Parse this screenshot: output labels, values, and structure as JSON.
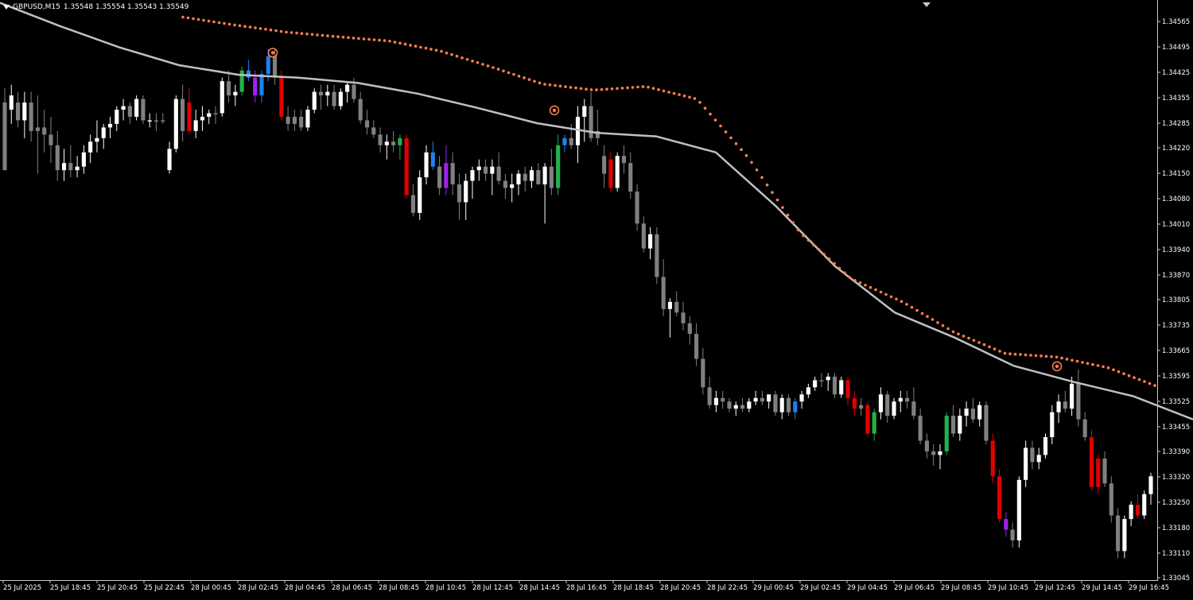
{
  "header": {
    "symbol_timeframe": "GBPUSD,M15",
    "ohlc": "1.35548 1.35554 1.35543 1.35549"
  },
  "colors": {
    "background": "#000000",
    "bull_candle": "#ffffff",
    "bear_candle": "#808080",
    "highlight_green": "#22b14c",
    "highlight_blue": "#1e7ff0",
    "highlight_purple": "#a020f0",
    "highlight_red": "#e00000",
    "moving_average": "#c0c0c0",
    "dotted_band": "#ff7f50",
    "signal_marker": "#ff7f50",
    "axis_text": "#ffffff"
  },
  "chart_data": {
    "type": "candlestick",
    "ylim": [
      1.33045,
      1.3461
    ],
    "y_ticks": [
      "1.34565",
      "1.34495",
      "1.34425",
      "1.34355",
      "1.34285",
      "1.34220",
      "1.34150",
      "1.34080",
      "1.34010",
      "1.33940",
      "1.33870",
      "1.33805",
      "1.33735",
      "1.33665",
      "1.33595",
      "1.33525",
      "1.33455",
      "1.33390",
      "1.33320",
      "1.33250",
      "1.33180",
      "1.33110",
      "1.33045"
    ],
    "x_ticks": [
      "25 Jul 2025",
      "25 Jul 18:45",
      "25 Jul 20:45",
      "25 Jul 22:45",
      "28 Jul 00:45",
      "28 Jul 02:45",
      "28 Jul 04:45",
      "28 Jul 06:45",
      "28 Jul 08:45",
      "28 Jul 10:45",
      "28 Jul 12:45",
      "28 Jul 14:45",
      "28 Jul 16:45",
      "28 Jul 18:45",
      "28 Jul 20:45",
      "28 Jul 22:45",
      "29 Jul 00:45",
      "29 Jul 02:45",
      "29 Jul 04:45",
      "29 Jul 06:45",
      "29 Jul 08:45",
      "29 Jul 10:45",
      "29 Jul 12:45",
      "29 Jul 14:45",
      "29 Jul 16:45"
    ],
    "moving_average": [
      1.3466,
      1.34595,
      1.34535,
      1.34485,
      1.34458,
      1.3445,
      1.34435,
      1.34405,
      1.34365,
      1.34322,
      1.34295,
      1.34285,
      1.3424,
      1.3409,
      1.3392,
      1.3379,
      1.3372,
      1.3364,
      1.33595,
      1.33555,
      1.3349
    ],
    "upper_band": [
      1.3462,
      1.34598,
      1.34578,
      1.34565,
      1.34553,
      1.34525,
      1.3448,
      1.34432,
      1.34415,
      1.34425,
      1.3439,
      1.34225,
      1.34015,
      1.33885,
      1.3382,
      1.33735,
      1.33675,
      1.33665,
      1.33635,
      1.3358
    ],
    "signals": [
      1.3452,
      1.34358,
      1.33639
    ],
    "candles": [
      [
        1.3438,
        1.3442,
        1.3419,
        1.3419,
        "bear"
      ],
      [
        1.3436,
        1.3443,
        1.3432,
        1.344,
        "bull"
      ],
      [
        1.3438,
        1.3441,
        1.3431,
        1.3433,
        "bear"
      ],
      [
        1.3433,
        1.3441,
        1.3428,
        1.3438,
        "bull"
      ],
      [
        1.3438,
        1.3441,
        1.3427,
        1.343,
        "bear"
      ],
      [
        1.343,
        1.344,
        1.3418,
        1.3431,
        "bear"
      ],
      [
        1.3431,
        1.3436,
        1.3424,
        1.3429,
        "bear"
      ],
      [
        1.3429,
        1.3434,
        1.3421,
        1.3426,
        "bear"
      ],
      [
        1.3426,
        1.343,
        1.3416,
        1.3419,
        "bear"
      ],
      [
        1.3419,
        1.3425,
        1.3416,
        1.3421,
        "bull"
      ],
      [
        1.3421,
        1.3426,
        1.3417,
        1.3419,
        "bear"
      ],
      [
        1.3419,
        1.3423,
        1.3417,
        1.342,
        "bull"
      ],
      [
        1.342,
        1.3426,
        1.3418,
        1.3424,
        "bull"
      ],
      [
        1.3424,
        1.3429,
        1.3421,
        1.3427,
        "bull"
      ],
      [
        1.3427,
        1.3433,
        1.3424,
        1.3428,
        "bull"
      ],
      [
        1.3428,
        1.3432,
        1.3425,
        1.3431,
        "bull"
      ],
      [
        1.3431,
        1.3434,
        1.3428,
        1.3432,
        "bull"
      ],
      [
        1.3432,
        1.3437,
        1.343,
        1.3436,
        "bull"
      ],
      [
        1.3436,
        1.3439,
        1.3433,
        1.3437,
        "bull"
      ],
      [
        1.3437,
        1.3438,
        1.3432,
        1.3434,
        "bear"
      ],
      [
        1.3434,
        1.344,
        1.3433,
        1.3439,
        "bull"
      ],
      [
        1.3439,
        1.344,
        1.3432,
        1.3433,
        "bear"
      ],
      [
        1.3433,
        1.3435,
        1.3431,
        1.3433,
        "bull"
      ],
      [
        1.3433,
        1.3435,
        1.343,
        1.3433,
        "bear"
      ],
      [
        1.3433,
        1.3435,
        1.3432,
        1.3433,
        "bear"
      ],
      [
        1.3419,
        1.3427,
        1.3418,
        1.3425,
        "bull"
      ],
      [
        1.3425,
        1.344,
        1.3424,
        1.3439,
        "bull"
      ],
      [
        1.3439,
        1.3443,
        1.3427,
        1.343,
        "bear"
      ],
      [
        1.3438,
        1.3442,
        1.3429,
        1.343,
        "red"
      ],
      [
        1.343,
        1.3436,
        1.3428,
        1.3433,
        "bull"
      ],
      [
        1.3433,
        1.3437,
        1.343,
        1.3434,
        "bull"
      ],
      [
        1.3434,
        1.3436,
        1.3432,
        1.3435,
        "bull"
      ],
      [
        1.3435,
        1.3437,
        1.3432,
        1.3435,
        "bear"
      ],
      [
        1.3435,
        1.3445,
        1.3434,
        1.3444,
        "bull"
      ],
      [
        1.3444,
        1.3447,
        1.3438,
        1.344,
        "bear"
      ],
      [
        1.344,
        1.3443,
        1.3437,
        1.3441,
        "bull"
      ],
      [
        1.3441,
        1.3448,
        1.344,
        1.3447,
        "green"
      ],
      [
        1.3447,
        1.345,
        1.3444,
        1.3445,
        "blue"
      ],
      [
        1.3445,
        1.3447,
        1.3438,
        1.344,
        "purple"
      ],
      [
        1.344,
        1.3447,
        1.3438,
        1.3446,
        "blue"
      ],
      [
        1.3446,
        1.3453,
        1.3444,
        1.3451,
        "blue"
      ],
      [
        1.3451,
        1.3453,
        1.3443,
        1.3445,
        "bear"
      ],
      [
        1.3445,
        1.3447,
        1.3433,
        1.3434,
        "red"
      ],
      [
        1.3434,
        1.3437,
        1.343,
        1.3432,
        "bear"
      ],
      [
        1.3432,
        1.3436,
        1.343,
        1.3434,
        "bear"
      ],
      [
        1.3434,
        1.3436,
        1.343,
        1.3431,
        "bear"
      ],
      [
        1.3431,
        1.3437,
        1.343,
        1.3436,
        "bull"
      ],
      [
        1.3436,
        1.3442,
        1.3435,
        1.3441,
        "bull"
      ],
      [
        1.3441,
        1.3443,
        1.3436,
        1.344,
        "bear"
      ],
      [
        1.344,
        1.3443,
        1.3437,
        1.3441,
        "bull"
      ],
      [
        1.3441,
        1.3443,
        1.3436,
        1.3437,
        "bear"
      ],
      [
        1.3437,
        1.3442,
        1.3436,
        1.3441,
        "bull"
      ],
      [
        1.3441,
        1.3444,
        1.3438,
        1.3443,
        "bull"
      ],
      [
        1.3443,
        1.3445,
        1.3438,
        1.3439,
        "bear"
      ],
      [
        1.3439,
        1.3441,
        1.3432,
        1.3433,
        "bear"
      ],
      [
        1.3433,
        1.3436,
        1.3429,
        1.3431,
        "bear"
      ],
      [
        1.3431,
        1.3433,
        1.3428,
        1.3429,
        "bear"
      ],
      [
        1.3429,
        1.3431,
        1.3424,
        1.3426,
        "bear"
      ],
      [
        1.3426,
        1.3429,
        1.3422,
        1.3427,
        "bull"
      ],
      [
        1.3427,
        1.343,
        1.3424,
        1.3426,
        "bear"
      ],
      [
        1.3426,
        1.3429,
        1.3422,
        1.3428,
        "green"
      ],
      [
        1.3428,
        1.3429,
        1.3411,
        1.3412,
        "red"
      ],
      [
        1.3412,
        1.3415,
        1.3406,
        1.3407,
        "bear"
      ],
      [
        1.3407,
        1.3419,
        1.3405,
        1.3417,
        "bull"
      ],
      [
        1.3417,
        1.3426,
        1.3415,
        1.3424,
        "bull"
      ],
      [
        1.3424,
        1.3427,
        1.3419,
        1.342,
        "blue"
      ],
      [
        1.342,
        1.3423,
        1.3412,
        1.3414,
        "bear"
      ],
      [
        1.3414,
        1.3426,
        1.3412,
        1.3421,
        "purple"
      ],
      [
        1.3421,
        1.3424,
        1.3412,
        1.3415,
        "bear"
      ],
      [
        1.3415,
        1.3418,
        1.3405,
        1.341,
        "bear"
      ],
      [
        1.341,
        1.3418,
        1.3405,
        1.3416,
        "bull"
      ],
      [
        1.3416,
        1.342,
        1.3411,
        1.3419,
        "bull"
      ],
      [
        1.3419,
        1.3422,
        1.3416,
        1.342,
        "bull"
      ],
      [
        1.342,
        1.3422,
        1.3416,
        1.3418,
        "bear"
      ],
      [
        1.3418,
        1.3422,
        1.3412,
        1.342,
        "bull"
      ],
      [
        1.342,
        1.3424,
        1.3415,
        1.3416,
        "bear"
      ],
      [
        1.3416,
        1.3418,
        1.3411,
        1.3414,
        "bear"
      ],
      [
        1.3414,
        1.3418,
        1.341,
        1.3415,
        "bull"
      ],
      [
        1.3415,
        1.3419,
        1.3412,
        1.3418,
        "bull"
      ],
      [
        1.3418,
        1.342,
        1.3413,
        1.3416,
        "bear"
      ],
      [
        1.3416,
        1.342,
        1.3414,
        1.3419,
        "bull"
      ],
      [
        1.3419,
        1.3421,
        1.3415,
        1.3415,
        "bear"
      ],
      [
        1.3415,
        1.3421,
        1.3404,
        1.342,
        "bull"
      ],
      [
        1.342,
        1.3425,
        1.3412,
        1.3414,
        "bear"
      ],
      [
        1.3414,
        1.3429,
        1.3412,
        1.3426,
        "green"
      ],
      [
        1.3426,
        1.3429,
        1.3424,
        1.3428,
        "blue"
      ],
      [
        1.3428,
        1.3432,
        1.3425,
        1.3426,
        "bear"
      ],
      [
        1.3426,
        1.3437,
        1.3421,
        1.3434,
        "bull"
      ],
      [
        1.3434,
        1.3439,
        1.3427,
        1.3437,
        "bull"
      ],
      [
        1.3437,
        1.3441,
        1.3427,
        1.3428,
        "bear"
      ],
      [
        1.3428,
        1.3436,
        1.3426,
        1.343,
        "bear"
      ],
      [
        1.3423,
        1.3426,
        1.3414,
        1.3418,
        "bear"
      ],
      [
        1.3422,
        1.3424,
        1.3413,
        1.3414,
        "red"
      ],
      [
        1.3414,
        1.3424,
        1.3413,
        1.3423,
        "bull"
      ],
      [
        1.3423,
        1.3426,
        1.3418,
        1.3421,
        "bear"
      ],
      [
        1.3421,
        1.3424,
        1.3411,
        1.3413,
        "bear"
      ],
      [
        1.3413,
        1.3415,
        1.3402,
        1.3404,
        "bear"
      ],
      [
        1.3404,
        1.3406,
        1.3396,
        1.3397,
        "bear"
      ],
      [
        1.3397,
        1.3403,
        1.3394,
        1.3401,
        "bull"
      ],
      [
        1.3401,
        1.3403,
        1.3387,
        1.3389,
        "bear"
      ],
      [
        1.3389,
        1.3394,
        1.3378,
        1.338,
        "bear"
      ],
      [
        1.338,
        1.3383,
        1.3372,
        1.3382,
        "bull"
      ],
      [
        1.3382,
        1.3385,
        1.3378,
        1.3379,
        "bear"
      ],
      [
        1.3379,
        1.3382,
        1.3374,
        1.3376,
        "bear"
      ],
      [
        1.3376,
        1.3378,
        1.337,
        1.3373,
        "bear"
      ],
      [
        1.3373,
        1.3376,
        1.3364,
        1.3366,
        "bear"
      ],
      [
        1.3366,
        1.3369,
        1.3356,
        1.3358,
        "bear"
      ],
      [
        1.3358,
        1.3361,
        1.3352,
        1.3353,
        "bear"
      ],
      [
        1.3353,
        1.3357,
        1.3351,
        1.3355,
        "bull"
      ],
      [
        1.3355,
        1.3357,
        1.3352,
        1.3354,
        "bear"
      ],
      [
        1.3354,
        1.3355,
        1.3351,
        1.3352,
        "bear"
      ],
      [
        1.3352,
        1.3354,
        1.335,
        1.3353,
        "bull"
      ],
      [
        1.3353,
        1.3355,
        1.3351,
        1.3352,
        "bear"
      ],
      [
        1.3352,
        1.3355,
        1.3351,
        1.3354,
        "bull"
      ],
      [
        1.3354,
        1.3357,
        1.3353,
        1.3355,
        "bull"
      ],
      [
        1.3355,
        1.3357,
        1.3353,
        1.3354,
        "bear"
      ],
      [
        1.3354,
        1.3356,
        1.3352,
        1.3356,
        "bull"
      ],
      [
        1.3356,
        1.3357,
        1.335,
        1.3351,
        "bear"
      ],
      [
        1.3351,
        1.3356,
        1.3349,
        1.3355,
        "bull"
      ],
      [
        1.3355,
        1.3356,
        1.335,
        1.3351,
        "bear"
      ],
      [
        1.3351,
        1.3355,
        1.3349,
        1.3354,
        "blue"
      ],
      [
        1.3354,
        1.3357,
        1.3352,
        1.3356,
        "bull"
      ],
      [
        1.3356,
        1.3359,
        1.3355,
        1.3358,
        "bull"
      ],
      [
        1.3358,
        1.3361,
        1.3357,
        1.336,
        "bull"
      ],
      [
        1.336,
        1.3362,
        1.3358,
        1.336,
        "bear"
      ],
      [
        1.336,
        1.3362,
        1.3357,
        1.3361,
        "bull"
      ],
      [
        1.3361,
        1.3362,
        1.3355,
        1.3356,
        "bear"
      ],
      [
        1.3356,
        1.3361,
        1.3355,
        1.336,
        "bull"
      ],
      [
        1.336,
        1.3361,
        1.3353,
        1.3355,
        "red"
      ],
      [
        1.3355,
        1.3357,
        1.335,
        1.3352,
        "red"
      ],
      [
        1.3352,
        1.3355,
        1.335,
        1.3353,
        "bear"
      ],
      [
        1.3353,
        1.3354,
        1.3344,
        1.3345,
        "red"
      ],
      [
        1.3345,
        1.3352,
        1.3343,
        1.3351,
        "green"
      ],
      [
        1.3351,
        1.3358,
        1.3349,
        1.3356,
        "bull"
      ],
      [
        1.3356,
        1.3357,
        1.3348,
        1.335,
        "bear"
      ],
      [
        1.335,
        1.3355,
        1.3349,
        1.3354,
        "bull"
      ],
      [
        1.3354,
        1.3357,
        1.3351,
        1.3355,
        "bull"
      ],
      [
        1.3355,
        1.3357,
        1.3352,
        1.3354,
        "bear"
      ],
      [
        1.3354,
        1.3358,
        1.3349,
        1.335,
        "bear"
      ],
      [
        1.335,
        1.3352,
        1.3342,
        1.3343,
        "bear"
      ],
      [
        1.3343,
        1.3345,
        1.3338,
        1.334,
        "bear"
      ],
      [
        1.334,
        1.3342,
        1.3336,
        1.3339,
        "bear"
      ],
      [
        1.3339,
        1.3342,
        1.3335,
        1.334,
        "bull"
      ],
      [
        1.334,
        1.3351,
        1.3339,
        1.335,
        "green"
      ],
      [
        1.335,
        1.3353,
        1.3344,
        1.3345,
        "bear"
      ],
      [
        1.3345,
        1.3352,
        1.3343,
        1.335,
        "bull"
      ],
      [
        1.335,
        1.3354,
        1.3347,
        1.3352,
        "bull"
      ],
      [
        1.3352,
        1.3355,
        1.3348,
        1.3349,
        "bear"
      ],
      [
        1.3349,
        1.3354,
        1.3347,
        1.3353,
        "bull"
      ],
      [
        1.3353,
        1.3354,
        1.3342,
        1.3343,
        "bear"
      ],
      [
        1.3343,
        1.3345,
        1.3331,
        1.3333,
        "red"
      ],
      [
        1.3333,
        1.3335,
        1.332,
        1.3321,
        "red"
      ],
      [
        1.3321,
        1.3323,
        1.3316,
        1.3318,
        "purple"
      ],
      [
        1.3318,
        1.332,
        1.3313,
        1.3315,
        "bear"
      ],
      [
        1.3315,
        1.3333,
        1.3313,
        1.3332,
        "bull"
      ],
      [
        1.3332,
        1.3343,
        1.333,
        1.3341,
        "bull"
      ],
      [
        1.3341,
        1.3343,
        1.3335,
        1.3337,
        "bear"
      ],
      [
        1.3337,
        1.3341,
        1.3335,
        1.3339,
        "bull"
      ],
      [
        1.3339,
        1.3345,
        1.3338,
        1.3344,
        "bull"
      ],
      [
        1.3344,
        1.3353,
        1.3342,
        1.3351,
        "bull"
      ],
      [
        1.3351,
        1.3356,
        1.3348,
        1.3354,
        "bull"
      ],
      [
        1.3354,
        1.3357,
        1.3351,
        1.3352,
        "bear"
      ],
      [
        1.3352,
        1.3361,
        1.335,
        1.3359,
        "bull"
      ],
      [
        1.3359,
        1.3363,
        1.3347,
        1.3349,
        "bear"
      ],
      [
        1.3349,
        1.3351,
        1.3343,
        1.3344,
        "bear"
      ],
      [
        1.3344,
        1.3346,
        1.3329,
        1.333,
        "red"
      ],
      [
        1.333,
        1.3339,
        1.3328,
        1.3338,
        "red"
      ],
      [
        1.3338,
        1.334,
        1.333,
        1.3331,
        "bear"
      ],
      [
        1.3331,
        1.3333,
        1.332,
        1.3322,
        "bear"
      ],
      [
        1.3322,
        1.3324,
        1.331,
        1.3312,
        "bear"
      ],
      [
        1.3312,
        1.3322,
        1.331,
        1.3321,
        "bull"
      ],
      [
        1.3321,
        1.3326,
        1.3319,
        1.3325,
        "bull"
      ],
      [
        1.3325,
        1.3328,
        1.3321,
        1.3322,
        "red"
      ],
      [
        1.3322,
        1.3329,
        1.3321,
        1.3328,
        "bull"
      ],
      [
        1.3328,
        1.3334,
        1.3325,
        1.3333,
        "bull"
      ]
    ]
  }
}
